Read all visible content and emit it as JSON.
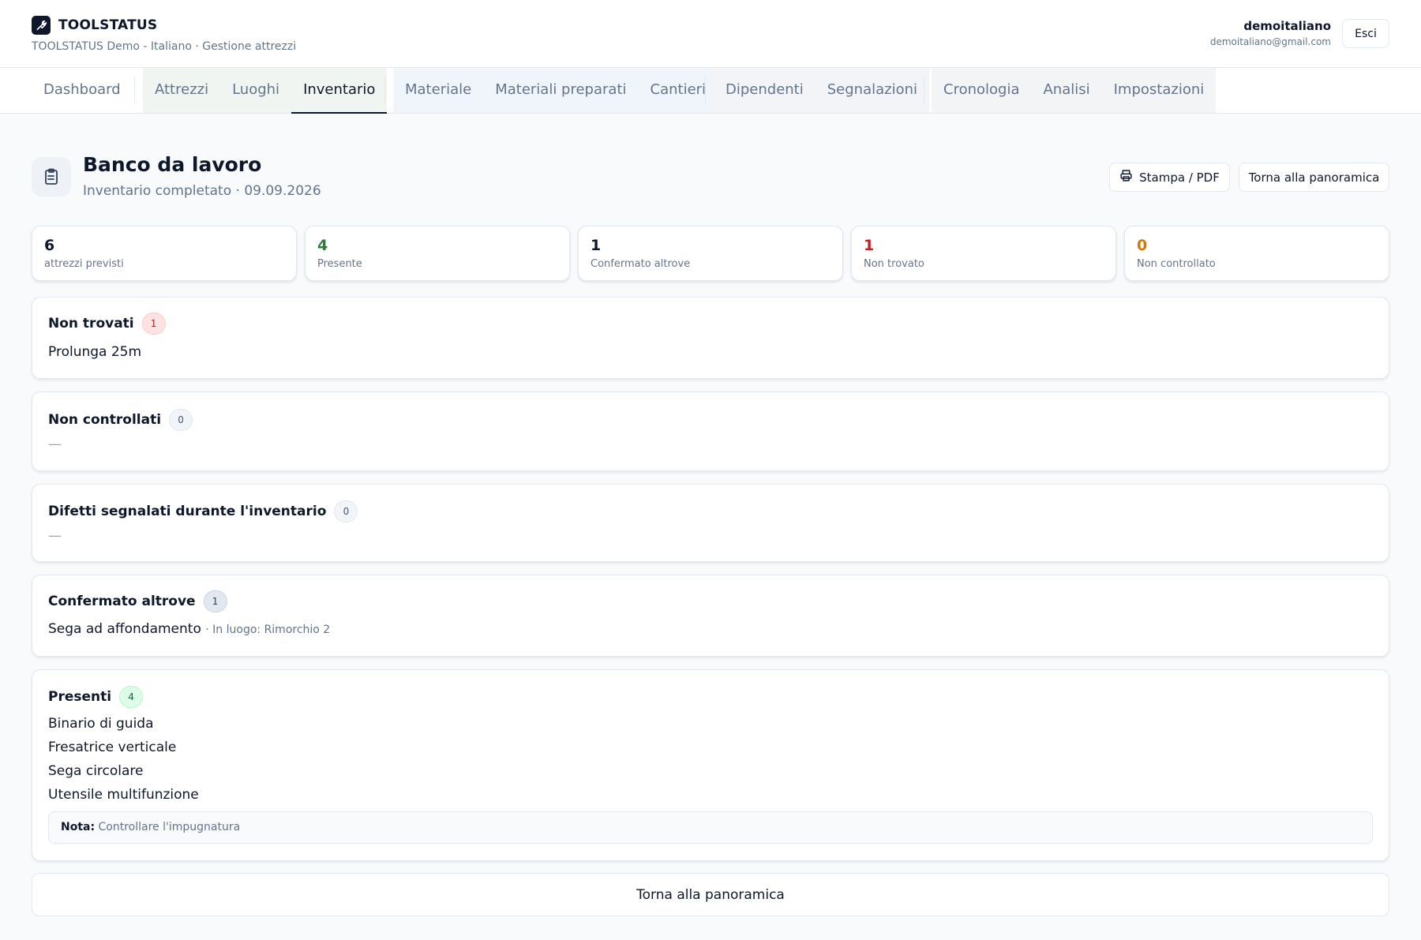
{
  "header": {
    "app_name": "TOOLSTATUS",
    "subtitle": "TOOLSTATUS Demo - Italiano · Gestione attrezzi",
    "user_name": "demoitaliano",
    "user_email": "demoitaliano@gmail.com",
    "logout_label": "Esci"
  },
  "nav": {
    "tabs": [
      "Dashboard",
      "Attrezzi",
      "Luoghi",
      "Inventario",
      "Materiale",
      "Materiali preparati",
      "Cantieri",
      "Dipendenti",
      "Segnalazioni",
      "Cronologia",
      "Analisi",
      "Impostazioni"
    ],
    "active": "Inventario"
  },
  "page": {
    "title": "Banco da lavoro",
    "subtitle": "Inventario completato · 09.09.2026",
    "print_label": "Stampa / PDF",
    "back_label": "Torna alla panoramica"
  },
  "stats": [
    {
      "value": "6",
      "label": "attrezzi previsti",
      "color": "#0f172a"
    },
    {
      "value": "4",
      "label": "Presente",
      "color": "#2f7d3a"
    },
    {
      "value": "1",
      "label": "Confermato altrove",
      "color": "#0f172a"
    },
    {
      "value": "1",
      "label": "Non trovato",
      "color": "#c81e1e"
    },
    {
      "value": "0",
      "label": "Non controllato",
      "color": "#d17a0b"
    }
  ],
  "sections": {
    "not_found": {
      "title": "Non trovati",
      "count": "1",
      "items": [
        "Prolunga 25m"
      ]
    },
    "not_checked": {
      "title": "Non controllati",
      "count": "0",
      "empty": "—"
    },
    "defects": {
      "title": "Difetti segnalati durante l'inventario",
      "count": "0",
      "empty": "—"
    },
    "elsewhere": {
      "title": "Confermato altrove",
      "count": "1",
      "item": "Sega ad affondamento",
      "item_note": "· In luogo: Rimorchio 2"
    },
    "present": {
      "title": "Presenti",
      "count": "4",
      "items": [
        "Binario di guida",
        "Fresatrice verticale",
        "Sega circolare",
        "Utensile multifunzione"
      ],
      "note_label": "Nota:",
      "note_text": "Controllare l'impugnatura"
    }
  },
  "footer": {
    "back_label": "Torna alla panoramica"
  },
  "icons": {
    "logo": "wrench-icon",
    "title": "clipboard-icon",
    "print": "printer-icon"
  }
}
